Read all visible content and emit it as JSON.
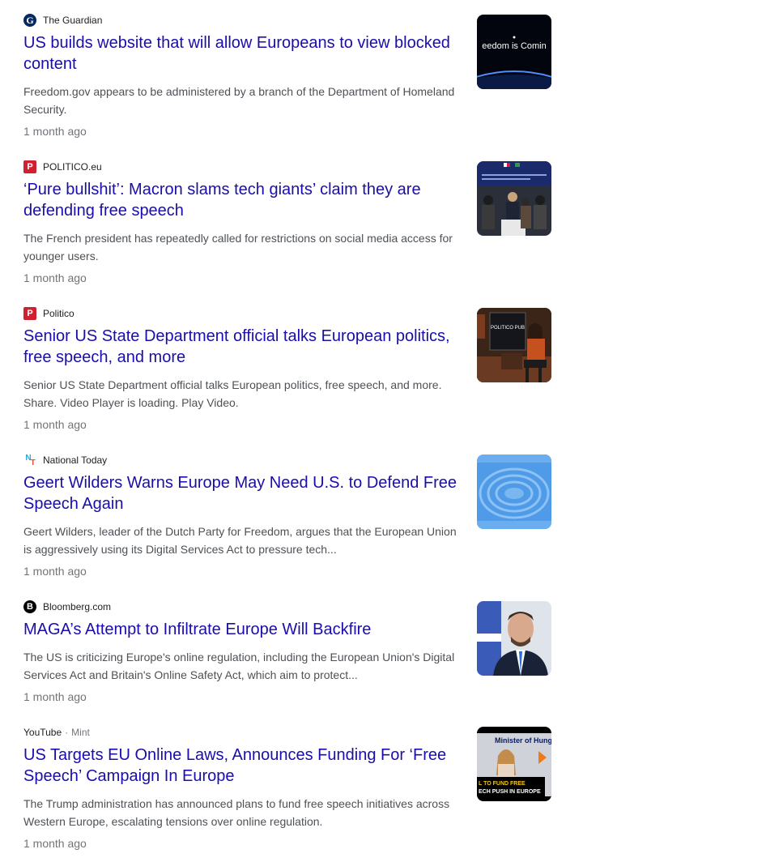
{
  "results": [
    {
      "source": "The Guardian",
      "favicon_icon": "guardian-logo-icon",
      "title": "US builds website that will allow Europeans to view blocked content",
      "snippet": "Freedom.gov appears to be administered by a branch of the Department of Homeland Security.",
      "age": "1 month ago",
      "thumb_text": "eedom is Comin"
    },
    {
      "source": "POLITICO.eu",
      "favicon_icon": "politico-logo-icon",
      "title": "‘Pure bullshit’: Macron slams tech giants’ claim they are defending free speech",
      "snippet": "The French president has repeatedly called for restrictions on social media access for younger users.",
      "age": "1 month ago"
    },
    {
      "source": "Politico",
      "favicon_icon": "politico-logo-icon",
      "title": "Senior US State Department official talks European politics, free speech, and more",
      "snippet": "Senior US State Department official talks European politics, free speech, and more. Share. Video Player is loading. Play Video.",
      "age": "1 month ago",
      "thumb_text": "POLITICO PUB"
    },
    {
      "source": "National Today",
      "favicon_icon": "national-today-logo-icon",
      "title": "Geert Wilders Warns Europe May Need U.S. to Defend Free Speech Again",
      "snippet": "Geert Wilders, leader of the Dutch Party for Freedom, argues that the European Union is aggressively using its Digital Services Act to pressure tech...",
      "age": "1 month ago"
    },
    {
      "source": "Bloomberg.com",
      "favicon_icon": "bloomberg-logo-icon",
      "title": "MAGA’s Attempt to Infiltrate Europe Will Backfire",
      "snippet": "The US is criticizing Europe's online regulation, including the European Union's Digital Services Act and Britain's Online Safety Act, which aim to protect...",
      "age": "1 month ago"
    },
    {
      "source": "YouTube",
      "source_sub": "Mint",
      "source_sep": "·",
      "title": "US Targets EU Online Laws, Announces Funding For ‘Free Speech’ Campaign In Europe",
      "snippet": "The Trump administration has announced plans to fund free speech initiatives across Western Europe, escalating tensions over online regulation.",
      "age": "1 month ago",
      "thumb_text_1": "Minister of Hung",
      "thumb_text_2": "L TO FUND FREE",
      "thumb_text_3": "ECH PUSH IN EUROPE"
    }
  ],
  "colors": {
    "link": "#1a0dab",
    "snippet": "#4d5156",
    "meta": "#70757a"
  }
}
